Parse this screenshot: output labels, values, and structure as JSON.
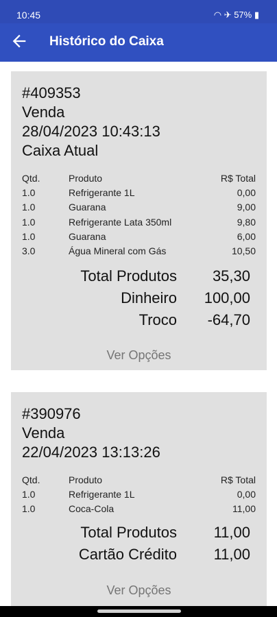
{
  "status": {
    "time": "10:45",
    "battery": "57%"
  },
  "app_bar": {
    "title": "Histórico do Caixa"
  },
  "cards": [
    {
      "id": "#409353",
      "type": "Venda",
      "datetime": "28/04/2023 10:43:13",
      "caixa": "Caixa Atual",
      "headers": {
        "qty": "Qtd.",
        "product": "Produto",
        "total": "R$ Total"
      },
      "items": [
        {
          "qty": "1.0",
          "product": "Refrigerante 1L",
          "total": "0,00"
        },
        {
          "qty": "1.0",
          "product": "Guarana",
          "total": "9,00"
        },
        {
          "qty": "1.0",
          "product": "Refrigerante Lata 350ml",
          "total": "9,80"
        },
        {
          "qty": "1.0",
          "product": "Guarana",
          "total": "6,00"
        },
        {
          "qty": "3.0",
          "product": "Água Mineral com Gás",
          "total": "10,50"
        }
      ],
      "summary": [
        {
          "label": "Total Produtos",
          "value": "35,30"
        },
        {
          "label": "Dinheiro",
          "value": "100,00"
        },
        {
          "label": "Troco",
          "value": "-64,70"
        }
      ],
      "action": "Ver Opções"
    },
    {
      "id": "#390976",
      "type": "Venda",
      "datetime": "22/04/2023 13:13:26",
      "headers": {
        "qty": "Qtd.",
        "product": "Produto",
        "total": "R$ Total"
      },
      "items": [
        {
          "qty": "1.0",
          "product": "Refrigerante 1L",
          "total": "0,00"
        },
        {
          "qty": "1.0",
          "product": "Coca-Cola",
          "total": "11,00"
        }
      ],
      "summary": [
        {
          "label": "Total Produtos",
          "value": "11,00"
        },
        {
          "label": "Cartão Crédito",
          "value": "11,00"
        }
      ],
      "action": "Ver Opções"
    }
  ]
}
